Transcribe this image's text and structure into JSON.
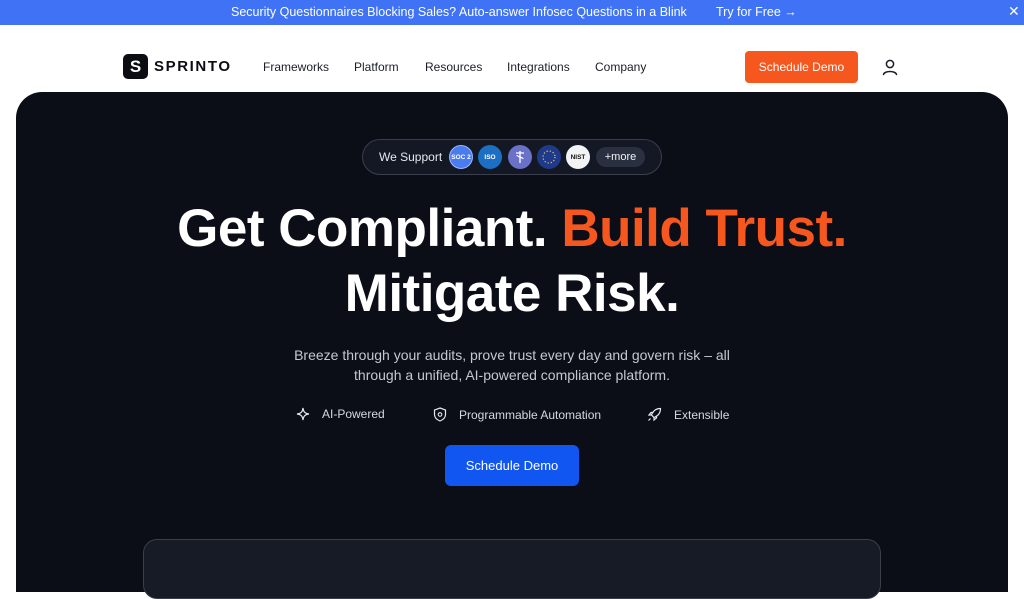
{
  "topbar": {
    "message": "Security Questionnaires Blocking Sales? Auto-answer Infosec Questions in a Blink",
    "cta": "Try for Free →",
    "close": "✕"
  },
  "nav": {
    "logo_mark": "S",
    "logo_text": "SPRINTO",
    "links": [
      "Frameworks",
      "Platform",
      "Resources",
      "Integrations",
      "Company"
    ],
    "demo_button": "Schedule Demo"
  },
  "hero": {
    "support_label": "We Support",
    "badges": [
      {
        "icon": "soc2-badge-icon",
        "text": "SOC 2",
        "color": "#4a7cf0"
      },
      {
        "icon": "iso-badge-icon",
        "text": "ISO",
        "color": "#1d6fc4"
      },
      {
        "icon": "hipaa-badge-icon",
        "text": "",
        "color": "#6a72c8"
      },
      {
        "icon": "gdpr-badge-icon",
        "text": "",
        "color": "#1f3a8a"
      },
      {
        "icon": "nist-badge-icon",
        "text": "NIST",
        "color": "#f2f3f5"
      }
    ],
    "more": "+more",
    "headline_1_white": "Get Compliant. ",
    "headline_1_orange": "Build Trust.",
    "headline_2": "Mitigate Risk.",
    "subtitle_1": "Breeze through your audits, prove trust every day and govern risk – all",
    "subtitle_2": "through a unified, AI-powered compliance platform.",
    "features": [
      {
        "icon": "sparkle-icon",
        "label": "AI-Powered"
      },
      {
        "icon": "shield-icon",
        "label": "Programmable Automation"
      },
      {
        "icon": "rocket-icon",
        "label": "Extensible"
      }
    ],
    "cta": "Schedule Demo"
  },
  "colors": {
    "accent_orange": "#f5571f",
    "accent_blue": "#1156f0",
    "topbar_blue": "#3f72f5",
    "hero_bg": "#0b0e16"
  }
}
